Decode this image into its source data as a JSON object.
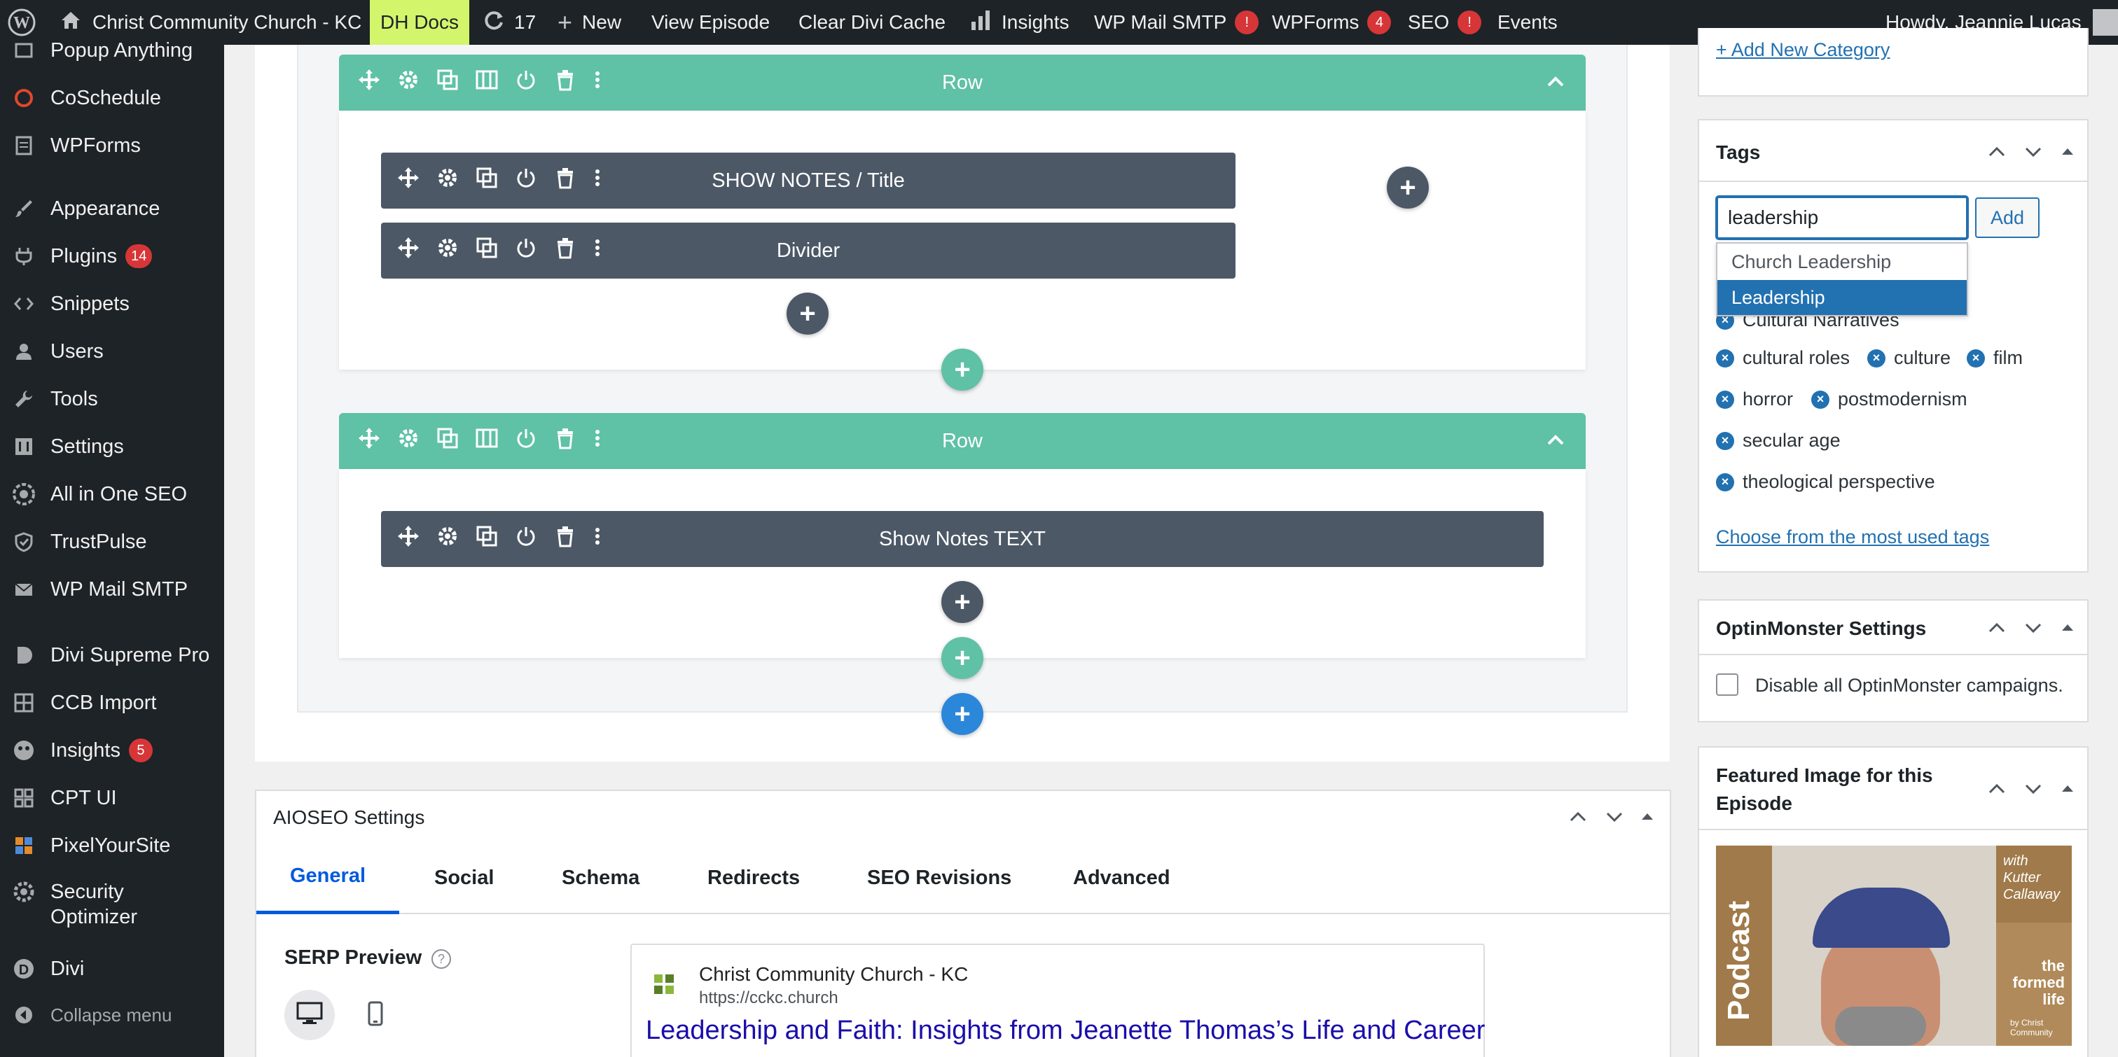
{
  "admin_bar": {
    "site_name": "Christ Community Church - KC",
    "dh_docs": "DH Docs",
    "updates_count": "17",
    "new_label": "New",
    "view_episode": "View Episode",
    "clear_cache": "Clear Divi Cache",
    "insights": "Insights",
    "wp_mail_smtp": "WP Mail SMTP",
    "wp_mail_badge": "!",
    "wpforms": "WPForms",
    "wpforms_badge": "4",
    "seo": "SEO",
    "seo_badge": "!",
    "events": "Events",
    "howdy": "Howdy, Jeannie Lucas"
  },
  "sidebar": {
    "items": [
      {
        "label": "Popup Anything",
        "icon": "popup-icon"
      },
      {
        "label": "CoSchedule",
        "icon": "coschedule-icon"
      },
      {
        "label": "WPForms",
        "icon": "wpforms-icon"
      },
      {
        "label": "Appearance",
        "icon": "brush-icon"
      },
      {
        "label": "Plugins",
        "icon": "plug-icon",
        "badge": "14"
      },
      {
        "label": "Snippets",
        "icon": "snippets-icon"
      },
      {
        "label": "Users",
        "icon": "users-icon"
      },
      {
        "label": "Tools",
        "icon": "wrench-icon"
      },
      {
        "label": "Settings",
        "icon": "settings-icon"
      },
      {
        "label": "All in One SEO",
        "icon": "aioseo-icon"
      },
      {
        "label": "TrustPulse",
        "icon": "trustpulse-icon"
      },
      {
        "label": "WP Mail SMTP",
        "icon": "mail-icon"
      },
      {
        "label": "Divi Supreme Pro",
        "icon": "divi-supreme-icon"
      },
      {
        "label": "CCB Import",
        "icon": "import-icon"
      },
      {
        "label": "Insights",
        "icon": "insights-icon",
        "badge": "5"
      },
      {
        "label": "CPT UI",
        "icon": "cptui-icon"
      },
      {
        "label": "PixelYourSite",
        "icon": "pixelyoursite-icon"
      },
      {
        "label": "Security",
        "label2": "Optimizer",
        "icon": "security-icon"
      },
      {
        "label": "Divi",
        "icon": "divi-icon"
      }
    ],
    "collapse": "Collapse menu"
  },
  "builder": {
    "row_label": "Row",
    "modules": {
      "show_notes_title": "SHOW NOTES / Title",
      "divider": "Divider",
      "show_notes_text": "Show Notes TEXT"
    }
  },
  "aioseo": {
    "title": "AIOSEO Settings",
    "tabs": [
      "General",
      "Social",
      "Schema",
      "Redirects",
      "SEO Revisions",
      "Advanced"
    ],
    "serp_label": "SERP Preview",
    "serp_site": "Christ Community Church - KC",
    "serp_url": "https://cckc.church",
    "serp_title": "Leadership and Faith: Insights from Jeanette Thomas’s Life and Career"
  },
  "categories": {
    "add_new": "+ Add New Category"
  },
  "tags": {
    "title": "Tags",
    "input_value": "leadership",
    "add_button": "Add",
    "suggestions": [
      "Church Leadership",
      "Leadership"
    ],
    "list": [
      "Cultural Narratives",
      "cultural roles",
      "culture",
      "film",
      "horror",
      "postmodernism",
      "secular age",
      "theological perspective"
    ],
    "most_used": "Choose from the most used tags"
  },
  "optinmonster": {
    "title": "OptinMonster Settings",
    "checkbox_label": "Disable all OptinMonster campaigns."
  },
  "featured": {
    "title_line1": "Featured Image for this",
    "title_line2": "Episode",
    "image_text_podcast": "Podcast",
    "image_text_with": "with",
    "image_text_name1": "Kutter",
    "image_text_name2": "Callaway",
    "image_text_brand1": "the",
    "image_text_brand2": "formed",
    "image_text_brand3": "life",
    "image_text_by1": "by Christ",
    "image_text_by2": "Community"
  },
  "colors": {
    "row_accent": "#5fc1a5",
    "module_dark": "#4c5866",
    "admin_bar_bg": "#1d2327",
    "link_blue": "#2271b1",
    "highlight_yellow": "#d3f56c"
  }
}
